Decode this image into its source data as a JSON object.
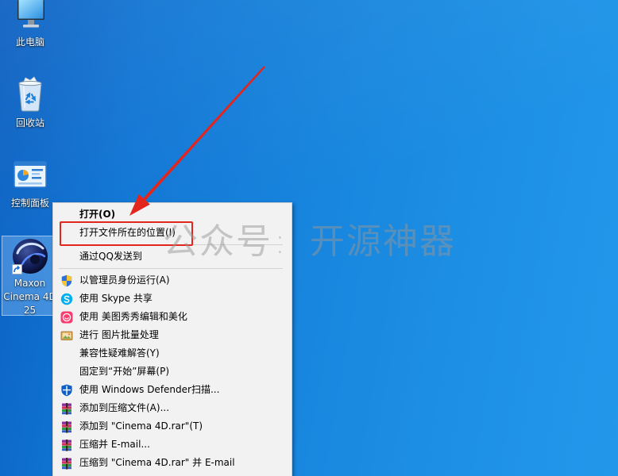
{
  "desktop": {
    "icons": [
      {
        "label": "此电脑",
        "icon": "this-pc-icon"
      },
      {
        "label": "回收站",
        "icon": "recycle-bin-icon"
      },
      {
        "label": "控制面板",
        "icon": "control-panel-icon"
      },
      {
        "label_lines": [
          "Maxon",
          "Cinema 4D",
          "25"
        ],
        "icon": "cinema4d-icon",
        "overlay_icon": "shortcut-arrow-icon",
        "selected": true
      }
    ]
  },
  "context_menu": {
    "groups": [
      [
        {
          "label": "打开(O)",
          "icon": null,
          "default": true
        },
        {
          "label": "打开文件所在的位置(I)",
          "icon": null,
          "highlighted_by_annotation": true
        }
      ],
      [
        {
          "label": "通过QQ发送到",
          "icon": null
        }
      ],
      [
        {
          "label": "以管理员身份运行(A)",
          "icon": "uac-shield-icon"
        },
        {
          "label": "使用 Skype 共享",
          "icon": "skype-icon"
        },
        {
          "label": "使用 美图秀秀编辑和美化",
          "icon": "meitu-icon"
        },
        {
          "label": "进行 图片批量处理",
          "icon": "batch-image-icon"
        },
        {
          "label": "兼容性疑难解答(Y)",
          "icon": null
        },
        {
          "label": "固定到“开始”屏幕(P)",
          "icon": null
        },
        {
          "label": "使用 Windows Defender扫描...",
          "icon": "defender-shield-icon"
        },
        {
          "label": "添加到压缩文件(A)...",
          "icon": "winrar-icon"
        },
        {
          "label": "添加到 \"Cinema 4D.rar\"(T)",
          "icon": "winrar-icon"
        },
        {
          "label": "压缩并 E-mail...",
          "icon": "winrar-icon"
        },
        {
          "label": "压缩到 \"Cinema 4D.rar\" 并 E-mail",
          "icon": "winrar-icon"
        }
      ]
    ]
  },
  "watermark": {
    "left": "公众号",
    "sep": ":",
    "right": "开源神器"
  },
  "colors": {
    "desktop_blue": "#1886de",
    "menu_background": "#f2f2f2",
    "annotation_red": "#e3261d"
  }
}
